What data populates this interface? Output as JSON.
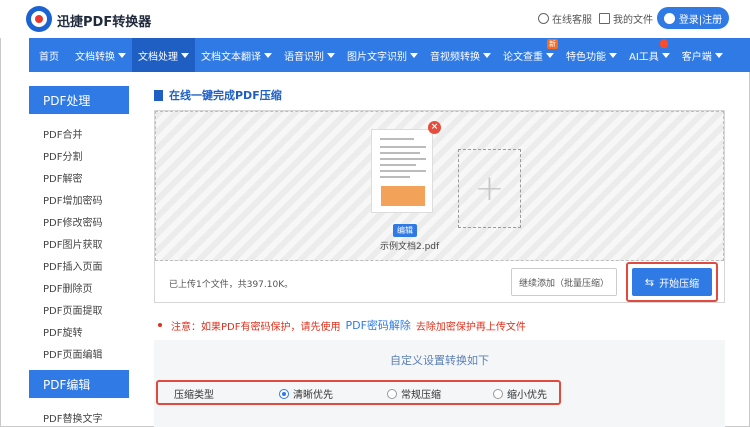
{
  "header": {
    "brand": "迅捷PDF转换器",
    "support": "在线客服",
    "my_files": "我的文件",
    "login": "登录|注册"
  },
  "nav": {
    "items": [
      {
        "label": "首页",
        "dropdown": false
      },
      {
        "label": "文档转换",
        "dropdown": true
      },
      {
        "label": "文档处理",
        "dropdown": true,
        "active": true
      },
      {
        "label": "文档文本翻译",
        "dropdown": true
      },
      {
        "label": "语音识别",
        "dropdown": true
      },
      {
        "label": "图片文字识别",
        "dropdown": true
      },
      {
        "label": "音视频转换",
        "dropdown": true
      },
      {
        "label": "论文查重",
        "dropdown": true,
        "badge": "新"
      },
      {
        "label": "特色功能",
        "dropdown": true
      },
      {
        "label": "AI工具",
        "dropdown": true,
        "hot": true
      },
      {
        "label": "客户端",
        "dropdown": true
      }
    ]
  },
  "sidebar": {
    "group1": "PDF处理",
    "items": [
      "PDF合并",
      "PDF分割",
      "PDF解密",
      "PDF增加密码",
      "PDF修改密码",
      "PDF图片获取",
      "PDF插入页面",
      "PDF删除页",
      "PDF页面提取",
      "PDF旋转",
      "PDF页面编辑"
    ],
    "group2": "PDF编辑",
    "items2": [
      "PDF替换文字"
    ]
  },
  "main": {
    "title": "在线一键完成PDF压缩",
    "file": {
      "name": "示例文档2.pdf",
      "edit_tag": "编辑"
    },
    "add_symbol": "+",
    "upload_info": "已上传1个文件，共397.10K。",
    "continue_btn": "继续添加（批量压缩）",
    "start_btn": "开始压缩",
    "notice_pre": "注意：如果PDF有密码保护，请先使用",
    "notice_link": "PDF密码解除",
    "notice_post": "去除加密保护再上传文件",
    "settings_title": "自定义设置转换如下",
    "compress_label": "压缩类型",
    "options": [
      {
        "label": "清晰优先",
        "selected": true
      },
      {
        "label": "常规压缩",
        "selected": false
      },
      {
        "label": "缩小优先",
        "selected": false
      }
    ]
  },
  "colors": {
    "accent": "#2f7ae5",
    "highlight": "#e04a3f",
    "warning": "#e0301e"
  }
}
